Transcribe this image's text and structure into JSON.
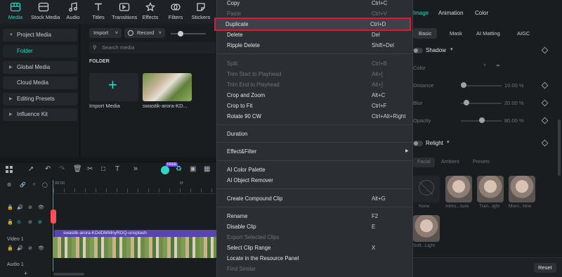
{
  "toolbar": {
    "items": [
      {
        "label": "Media",
        "icon": "media-icon"
      },
      {
        "label": "Stock Media",
        "icon": "stock-media-icon"
      },
      {
        "label": "Audio",
        "icon": "music-icon"
      },
      {
        "label": "Titles",
        "icon": "titles-icon"
      },
      {
        "label": "Transitions",
        "icon": "transitions-icon"
      },
      {
        "label": "Effects",
        "icon": "effects-icon"
      },
      {
        "label": "Filters",
        "icon": "filters-icon"
      },
      {
        "label": "Stickers",
        "icon": "stickers-icon"
      }
    ]
  },
  "sidebar": {
    "items": [
      {
        "label": "Project Media",
        "type": "head"
      },
      {
        "label": "Folder",
        "type": "sel"
      },
      {
        "label": "Global Media",
        "type": "head"
      },
      {
        "label": "Cloud Media",
        "type": "head"
      },
      {
        "label": "Editing Presets",
        "type": "head"
      },
      {
        "label": "Influence Kit",
        "type": "head"
      }
    ]
  },
  "media": {
    "import_label": "Import",
    "record_label": "Record",
    "search_placeholder": "Search media",
    "folder_label": "FOLDER",
    "import_media_label": "Import Media",
    "clip_name": "swastik-arora-KD..."
  },
  "timeline": {
    "ruler_start": "00:00",
    "ruler_mark": "6f",
    "video_track_label": "Video 1",
    "audio_track_label": "Audio 1",
    "clip_title": "swastik-arora-KDdDMMnyRGQ-unsplash",
    "ai_badge": "FREE"
  },
  "context_menu": {
    "items": [
      {
        "label": "Copy",
        "shortcut": "Ctrl+C",
        "state": "normal"
      },
      {
        "label": "Paste",
        "shortcut": "Ctrl+V",
        "state": "disabled"
      },
      {
        "label": "Duplicate",
        "shortcut": "Ctrl+D",
        "state": "highlight"
      },
      {
        "label": "Delete",
        "shortcut": "Del",
        "state": "normal"
      },
      {
        "label": "Ripple Delete",
        "shortcut": "Shift+Del",
        "state": "normal"
      },
      {
        "label": "Split",
        "shortcut": "Ctrl+B",
        "state": "disabled"
      },
      {
        "label": "Trim Start to Playhead",
        "shortcut": "Alt+[",
        "state": "disabled"
      },
      {
        "label": "Trim End to Playhead",
        "shortcut": "Alt+]",
        "state": "disabled"
      },
      {
        "label": "Crop and Zoom",
        "shortcut": "Alt+C",
        "state": "normal"
      },
      {
        "label": "Crop to Fit",
        "shortcut": "Ctrl+F",
        "state": "normal"
      },
      {
        "label": "Rotate 90 CW",
        "shortcut": "Ctrl+Alt+Right",
        "state": "normal"
      },
      {
        "label": "Duration",
        "shortcut": "",
        "state": "normal"
      },
      {
        "label": "Effect&Filter",
        "shortcut": "",
        "state": "normal"
      },
      {
        "label": "AI Color Palette",
        "shortcut": "",
        "state": "normal"
      },
      {
        "label": "AI Object Remover",
        "shortcut": "",
        "state": "normal"
      },
      {
        "label": "Create Compound Clip",
        "shortcut": "Alt+G",
        "state": "normal"
      },
      {
        "label": "Rename",
        "shortcut": "F2",
        "state": "normal"
      },
      {
        "label": "Disable Clip",
        "shortcut": "E",
        "state": "normal"
      },
      {
        "label": "Export Selected Clips",
        "shortcut": "",
        "state": "disabled"
      },
      {
        "label": "Select Clip Range",
        "shortcut": "X",
        "state": "normal"
      },
      {
        "label": "Locate in the Resource Panel",
        "shortcut": "",
        "state": "normal"
      },
      {
        "label": "Find Similar",
        "shortcut": "",
        "state": "disabled"
      }
    ]
  },
  "right_panel": {
    "tabs": [
      "Image",
      "Animation",
      "Color"
    ],
    "subtabs": [
      "Basic",
      "Mask",
      "AI Matting",
      "AIGC"
    ],
    "shadow_label": "Shadow",
    "color_label": "Color",
    "distance_label": "Distance",
    "distance_value": "10.00 %",
    "blur_label": "Blur",
    "blur_value": "20.00 %",
    "opacity_label": "Opacity",
    "opacity_value": "80.00 %",
    "relight_label": "Relight",
    "relight_tabs": [
      "Facial",
      "Ambient",
      "Presets"
    ],
    "presets": [
      "None",
      "Atmo...sure",
      "Tran...ight",
      "Morn...hine",
      "Soft...Light"
    ],
    "reset_label": "Reset"
  }
}
